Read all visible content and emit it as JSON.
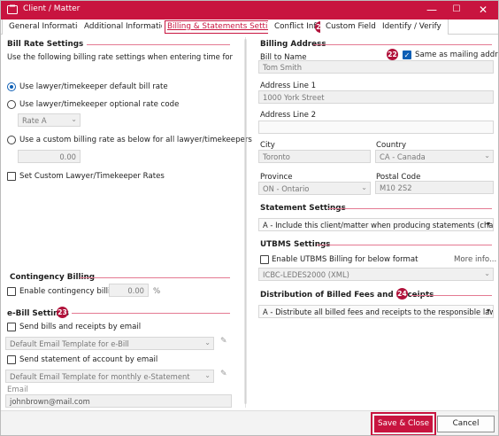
{
  "window": {
    "title": "Client / Matter",
    "minimize": "—",
    "maximize": "☐",
    "close": "✕"
  },
  "tabs": [
    {
      "label": "General Information"
    },
    {
      "label": "Additional Information"
    },
    {
      "label": "Billing & Statements Settings"
    },
    {
      "label": "Conflict Info"
    },
    {
      "label": "Custom Fields"
    },
    {
      "label": "Identify / Verify"
    }
  ],
  "badges": {
    "b25": "25",
    "b22": "22",
    "b23": "23",
    "b24": "24"
  },
  "bill_rate": {
    "title": "Bill Rate Settings",
    "description": "Use the following billing rate settings when entering time for lawyers/timekeepers",
    "opt_default": "Use lawyer/timekeeper default bill rate",
    "opt_optional": "Use lawyer/timekeeper optional rate code",
    "rate_code_value": "Rate A",
    "opt_custom": "Use a custom billing rate as below for all lawyer/timekeepers",
    "custom_rate_value": "0.00",
    "set_custom_rates": "Set Custom Lawyer/Timekeeper Rates"
  },
  "contingency": {
    "title": "Contingency Billing",
    "enable_label": "Enable contingency billing",
    "value": "0.00",
    "unit": "%"
  },
  "ebill": {
    "title": "e-Bill Settings",
    "send_bills_label": "Send bills and receipts by email",
    "bill_template": "Default Email Template for e-Bill",
    "send_statement_label": "Send statement of account by email",
    "statement_template": "Default Email Template for monthly e-Statement",
    "email_label": "Email",
    "email_value": "johnbrown@mail.com"
  },
  "billing_address": {
    "title": "Billing Address",
    "bill_to_label": "Bill to Name",
    "bill_to_value": "Tom Smith",
    "same_as_mailing": "Same as mailing address",
    "address1_label": "Address Line 1",
    "address1_value": "1000 York Street",
    "address2_label": "Address Line 2",
    "address2_value": "",
    "city_label": "City",
    "city_value": "Toronto",
    "country_label": "Country",
    "country_value": "CA - Canada",
    "province_label": "Province",
    "province_value": "ON - Ontario",
    "postal_label": "Postal Code",
    "postal_value": "M10 2S2"
  },
  "statement": {
    "title": "Statement Settings",
    "value": "A - Include this client/matter when producing statements (charge interest)"
  },
  "utbms": {
    "title": "UTBMS Settings",
    "enable_label": "Enable UTBMS Billing for below format",
    "more_info": "More info...",
    "format_value": "ICBC-LEDES2000 (XML)"
  },
  "distribution": {
    "title": "Distribution of Billed Fees and Receipts",
    "value": "A - Distribute all billed fees and receipts to the responsible lawyer/timekeeper"
  },
  "footer": {
    "save_close": "Save & Close",
    "cancel": "Cancel"
  },
  "colors": {
    "brand": "#c8143f",
    "accent": "#0e5fb5"
  }
}
